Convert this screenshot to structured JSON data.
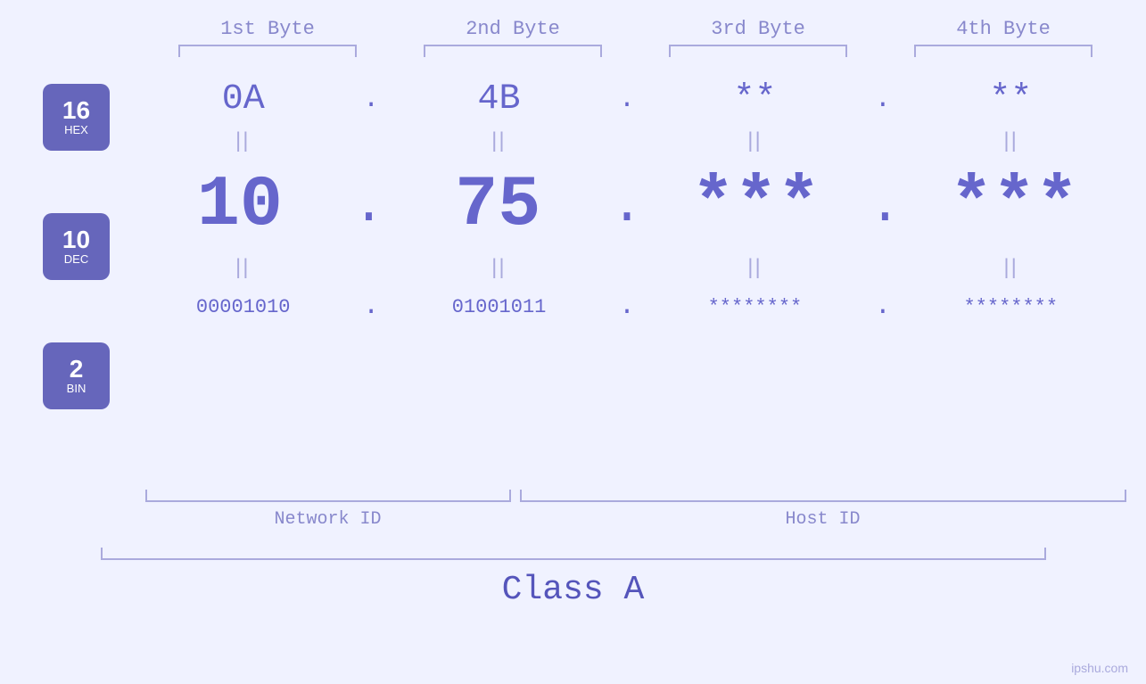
{
  "header": {
    "bytes": [
      "1st Byte",
      "2nd Byte",
      "3rd Byte",
      "4th Byte"
    ]
  },
  "badges": [
    {
      "number": "16",
      "label": "HEX"
    },
    {
      "number": "10",
      "label": "DEC"
    },
    {
      "number": "2",
      "label": "BIN"
    }
  ],
  "hex_row": {
    "values": [
      "0A",
      "4B",
      "**",
      "**"
    ],
    "dots": [
      ".",
      ".",
      ".",
      ""
    ]
  },
  "dec_row": {
    "values": [
      "10",
      "75",
      "***",
      "***"
    ],
    "dots": [
      ".",
      ".",
      ".",
      ""
    ]
  },
  "bin_row": {
    "values": [
      "00001010",
      "01001011",
      "********",
      "********"
    ],
    "dots": [
      ".",
      ".",
      ".",
      ""
    ]
  },
  "labels": {
    "network_id": "Network ID",
    "host_id": "Host ID",
    "class": "Class A"
  },
  "watermark": "ipshu.com",
  "equals": "||"
}
